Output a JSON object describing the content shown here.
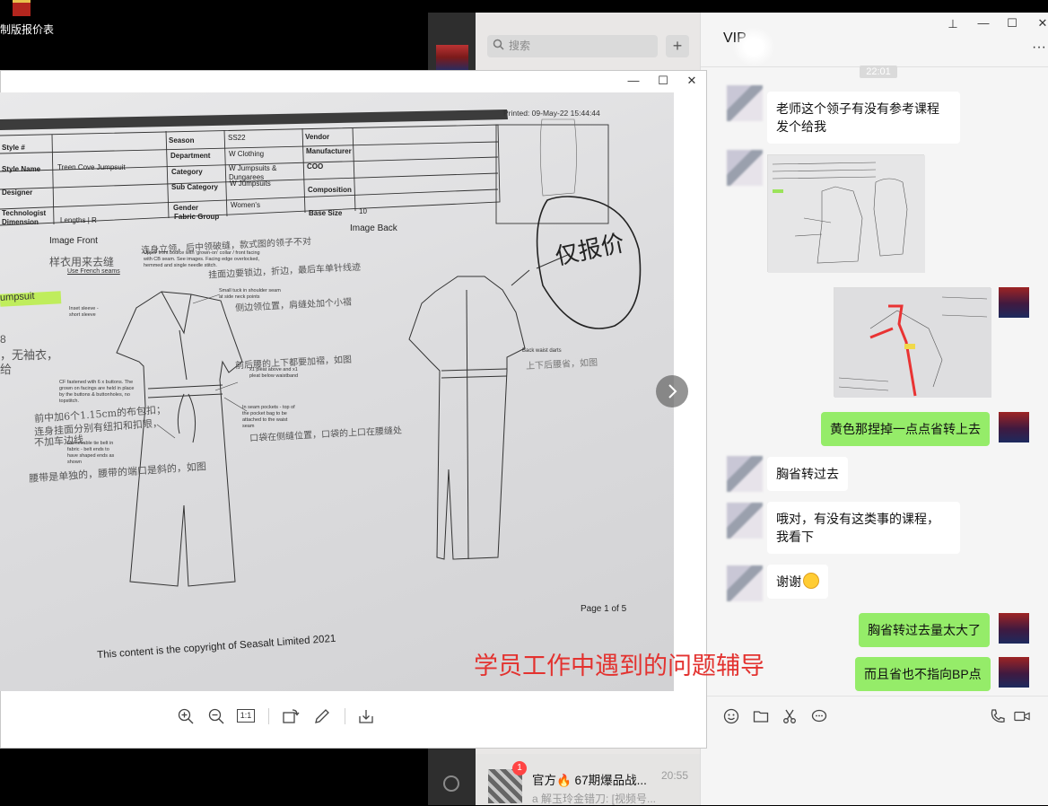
{
  "desktop": {
    "file_label": "制版报价表"
  },
  "chat_list": {
    "search_placeholder": "搜索",
    "add_label": "+",
    "item": {
      "title": "官方🔥 67期爆品战...",
      "time": "20:55",
      "preview": "a 解玉玲金错刀: [视频号...",
      "badge": "1"
    }
  },
  "chat": {
    "title": "VIP",
    "time_divider": "22:01",
    "window_controls": {
      "pin": "⊥",
      "minimize": "—",
      "maximize": "☐",
      "close": "✕",
      "more": "···"
    },
    "messages": [
      {
        "side": "in",
        "type": "text",
        "text": "老师这个领子有没有参考课程发个给我"
      },
      {
        "side": "in",
        "type": "image"
      },
      {
        "side": "out",
        "type": "image"
      },
      {
        "side": "out",
        "type": "text",
        "text": "黄色那捏掉一点点省转上去"
      },
      {
        "side": "in",
        "type": "text",
        "text": "胸省转过去"
      },
      {
        "side": "in",
        "type": "text",
        "text": "哦对，有没有这类事的课程，我看下"
      },
      {
        "side": "in",
        "type": "text",
        "text": "谢谢"
      },
      {
        "side": "out",
        "type": "text",
        "text": "胸省转过去量太大了"
      },
      {
        "side": "out",
        "type": "text",
        "text": "而且省也不指向BP点"
      }
    ],
    "toolbar_icons": [
      "emoji-icon",
      "folder-icon",
      "scissors-icon",
      "chat-bubble-icon",
      "phone-icon",
      "video-icon"
    ]
  },
  "viewer": {
    "controls": {
      "minimize": "—",
      "maximize": "☐",
      "close": "✕"
    },
    "overlay_caption": "学员工作中遇到的问题辅导",
    "actual_size_label": "1:1",
    "tools": [
      "zoom-in-icon",
      "zoom-out-icon",
      "actual-size-icon",
      "rotate-icon",
      "edit-icon",
      "download-icon"
    ]
  },
  "photo_document": {
    "printed": "Printed: 09-May-22 15:44:44",
    "spec_table": {
      "style_no_label": "Style #",
      "style_name_label": "Style Name",
      "style_name_value": "Treen Cove Jumpsuit",
      "designer_label": "Designer",
      "technologist_label": "Technologist",
      "dimension_label": "Dimension",
      "dimension_value": "Lengths | R",
      "season_label": "Season",
      "season_value": "SS22",
      "department_label": "Department",
      "department_value": "W Clothing",
      "category_label": "Category",
      "category_value": "W Jumpsuits & Dungarees",
      "sub_category_label": "Sub Category",
      "sub_category_value": "W Jumpsuits",
      "gender_label": "Gender",
      "gender_value": "Women's",
      "fabric_group_label": "Fabric Group",
      "vendor_label": "Vendor",
      "manufacturer_label": "Manufacturer",
      "coo_label": "COO",
      "composition_label": "Composition",
      "base_size_label": "Base Size",
      "base_size_value": "10"
    },
    "image_front": "Image Front",
    "image_back": "Image Back",
    "handwritten_circle": "仅报价",
    "use_french_seams": "Use French seams",
    "jumpsuit_highlight": "umpsuit",
    "page": "Page 1 of 5",
    "copyright": "This content is the copyright of  Seasalt Limited 2021",
    "annotations": {
      "a1": "样衣用来去缝",
      "a2": "连身立领，后中领破缝，款式图的领子不对",
      "a3": "Upper front bodice with 'grown-on' collar / front facing with CB seam. See images. Facing edge overlocked, hemmed and single needle stitch.",
      "a4": "挂面边要锁边，折边，最后车单针线迹",
      "a5": "Small tuck in shoulder seam at side neck points",
      "a6": "侧边领位置，肩缝处加个小褶",
      "a7": "Inset sleeve - short sleeve",
      "a8": "8",
      "a9": "，无袖衣，",
      "a10": "给",
      "a11": "前后腰的上下都要加褶，如图",
      "a12": "x1 pleat above and x1 pleat below waistband",
      "a13": "CF fastened with 6 x buttons. The grown on facings are held in place by the buttons & buttonholes, no topstitch.",
      "a14": "前中加6个1.15cm的布包扣；",
      "a15": "连身挂面分别有纽扣和扣眼，",
      "a16": "不加车边线",
      "a17": "In seam pockets - top of the pocket bag to be attached to the waist seam",
      "a18": "口袋在侧缝位置，口袋的上口在腰缝处",
      "a19": "Removable tie belt in fabric - belt ends to have shaped ends as shown",
      "a20": "腰带是单独的，腰带的端口是斜的，如图",
      "a21": "Back waist darts",
      "a22": "上下后腰省，如图"
    }
  },
  "colors": {
    "accent_green": "#95ec69",
    "caption_red": "#e3322f",
    "badge_red": "#f44444"
  }
}
